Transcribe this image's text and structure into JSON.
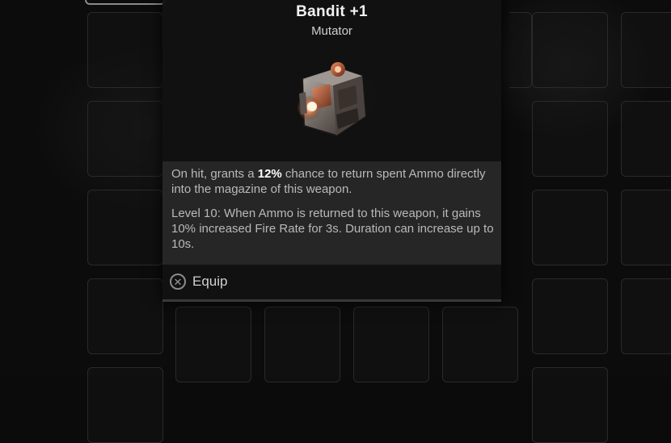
{
  "item": {
    "name": "Bandit +1",
    "type": "Mutator",
    "icon": "mutator-item-icon"
  },
  "description": {
    "line1_pre": "On hit, grants a ",
    "line1_highlight": "12%",
    "line1_post": " chance to return spent Ammo directly into the magazine of this weapon.",
    "level_text": "Level 10: When Ammo is returned to this weapon, it gains 10% increased Fire Rate for 3s. Duration can increase up to 10s."
  },
  "actions": {
    "equip_label": "Equip",
    "equip_icon": "cross-button-icon",
    "equip_glyph": "✕"
  },
  "colors": {
    "panel_bg": "#121212",
    "desc_bg": "#262626",
    "highlight": "#ffffff",
    "item_accent": "#e0653a"
  }
}
